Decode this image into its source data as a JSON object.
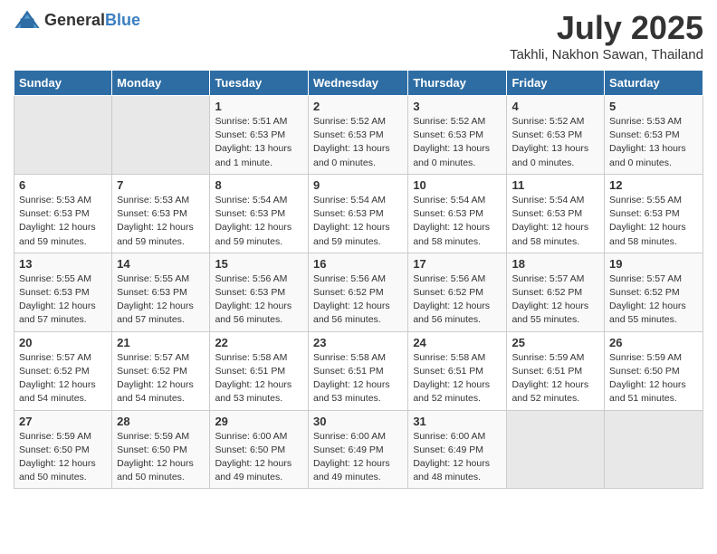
{
  "header": {
    "logo_general": "General",
    "logo_blue": "Blue",
    "title": "July 2025",
    "subtitle": "Takhli, Nakhon Sawan, Thailand"
  },
  "weekdays": [
    "Sunday",
    "Monday",
    "Tuesday",
    "Wednesday",
    "Thursday",
    "Friday",
    "Saturday"
  ],
  "weeks": [
    [
      {
        "day": "",
        "detail": ""
      },
      {
        "day": "",
        "detail": ""
      },
      {
        "day": "1",
        "detail": "Sunrise: 5:51 AM\nSunset: 6:53 PM\nDaylight: 13 hours\nand 1 minute."
      },
      {
        "day": "2",
        "detail": "Sunrise: 5:52 AM\nSunset: 6:53 PM\nDaylight: 13 hours\nand 0 minutes."
      },
      {
        "day": "3",
        "detail": "Sunrise: 5:52 AM\nSunset: 6:53 PM\nDaylight: 13 hours\nand 0 minutes."
      },
      {
        "day": "4",
        "detail": "Sunrise: 5:52 AM\nSunset: 6:53 PM\nDaylight: 13 hours\nand 0 minutes."
      },
      {
        "day": "5",
        "detail": "Sunrise: 5:53 AM\nSunset: 6:53 PM\nDaylight: 13 hours\nand 0 minutes."
      }
    ],
    [
      {
        "day": "6",
        "detail": "Sunrise: 5:53 AM\nSunset: 6:53 PM\nDaylight: 12 hours\nand 59 minutes."
      },
      {
        "day": "7",
        "detail": "Sunrise: 5:53 AM\nSunset: 6:53 PM\nDaylight: 12 hours\nand 59 minutes."
      },
      {
        "day": "8",
        "detail": "Sunrise: 5:54 AM\nSunset: 6:53 PM\nDaylight: 12 hours\nand 59 minutes."
      },
      {
        "day": "9",
        "detail": "Sunrise: 5:54 AM\nSunset: 6:53 PM\nDaylight: 12 hours\nand 59 minutes."
      },
      {
        "day": "10",
        "detail": "Sunrise: 5:54 AM\nSunset: 6:53 PM\nDaylight: 12 hours\nand 58 minutes."
      },
      {
        "day": "11",
        "detail": "Sunrise: 5:54 AM\nSunset: 6:53 PM\nDaylight: 12 hours\nand 58 minutes."
      },
      {
        "day": "12",
        "detail": "Sunrise: 5:55 AM\nSunset: 6:53 PM\nDaylight: 12 hours\nand 58 minutes."
      }
    ],
    [
      {
        "day": "13",
        "detail": "Sunrise: 5:55 AM\nSunset: 6:53 PM\nDaylight: 12 hours\nand 57 minutes."
      },
      {
        "day": "14",
        "detail": "Sunrise: 5:55 AM\nSunset: 6:53 PM\nDaylight: 12 hours\nand 57 minutes."
      },
      {
        "day": "15",
        "detail": "Sunrise: 5:56 AM\nSunset: 6:53 PM\nDaylight: 12 hours\nand 56 minutes."
      },
      {
        "day": "16",
        "detail": "Sunrise: 5:56 AM\nSunset: 6:52 PM\nDaylight: 12 hours\nand 56 minutes."
      },
      {
        "day": "17",
        "detail": "Sunrise: 5:56 AM\nSunset: 6:52 PM\nDaylight: 12 hours\nand 56 minutes."
      },
      {
        "day": "18",
        "detail": "Sunrise: 5:57 AM\nSunset: 6:52 PM\nDaylight: 12 hours\nand 55 minutes."
      },
      {
        "day": "19",
        "detail": "Sunrise: 5:57 AM\nSunset: 6:52 PM\nDaylight: 12 hours\nand 55 minutes."
      }
    ],
    [
      {
        "day": "20",
        "detail": "Sunrise: 5:57 AM\nSunset: 6:52 PM\nDaylight: 12 hours\nand 54 minutes."
      },
      {
        "day": "21",
        "detail": "Sunrise: 5:57 AM\nSunset: 6:52 PM\nDaylight: 12 hours\nand 54 minutes."
      },
      {
        "day": "22",
        "detail": "Sunrise: 5:58 AM\nSunset: 6:51 PM\nDaylight: 12 hours\nand 53 minutes."
      },
      {
        "day": "23",
        "detail": "Sunrise: 5:58 AM\nSunset: 6:51 PM\nDaylight: 12 hours\nand 53 minutes."
      },
      {
        "day": "24",
        "detail": "Sunrise: 5:58 AM\nSunset: 6:51 PM\nDaylight: 12 hours\nand 52 minutes."
      },
      {
        "day": "25",
        "detail": "Sunrise: 5:59 AM\nSunset: 6:51 PM\nDaylight: 12 hours\nand 52 minutes."
      },
      {
        "day": "26",
        "detail": "Sunrise: 5:59 AM\nSunset: 6:50 PM\nDaylight: 12 hours\nand 51 minutes."
      }
    ],
    [
      {
        "day": "27",
        "detail": "Sunrise: 5:59 AM\nSunset: 6:50 PM\nDaylight: 12 hours\nand 50 minutes."
      },
      {
        "day": "28",
        "detail": "Sunrise: 5:59 AM\nSunset: 6:50 PM\nDaylight: 12 hours\nand 50 minutes."
      },
      {
        "day": "29",
        "detail": "Sunrise: 6:00 AM\nSunset: 6:50 PM\nDaylight: 12 hours\nand 49 minutes."
      },
      {
        "day": "30",
        "detail": "Sunrise: 6:00 AM\nSunset: 6:49 PM\nDaylight: 12 hours\nand 49 minutes."
      },
      {
        "day": "31",
        "detail": "Sunrise: 6:00 AM\nSunset: 6:49 PM\nDaylight: 12 hours\nand 48 minutes."
      },
      {
        "day": "",
        "detail": ""
      },
      {
        "day": "",
        "detail": ""
      }
    ]
  ]
}
